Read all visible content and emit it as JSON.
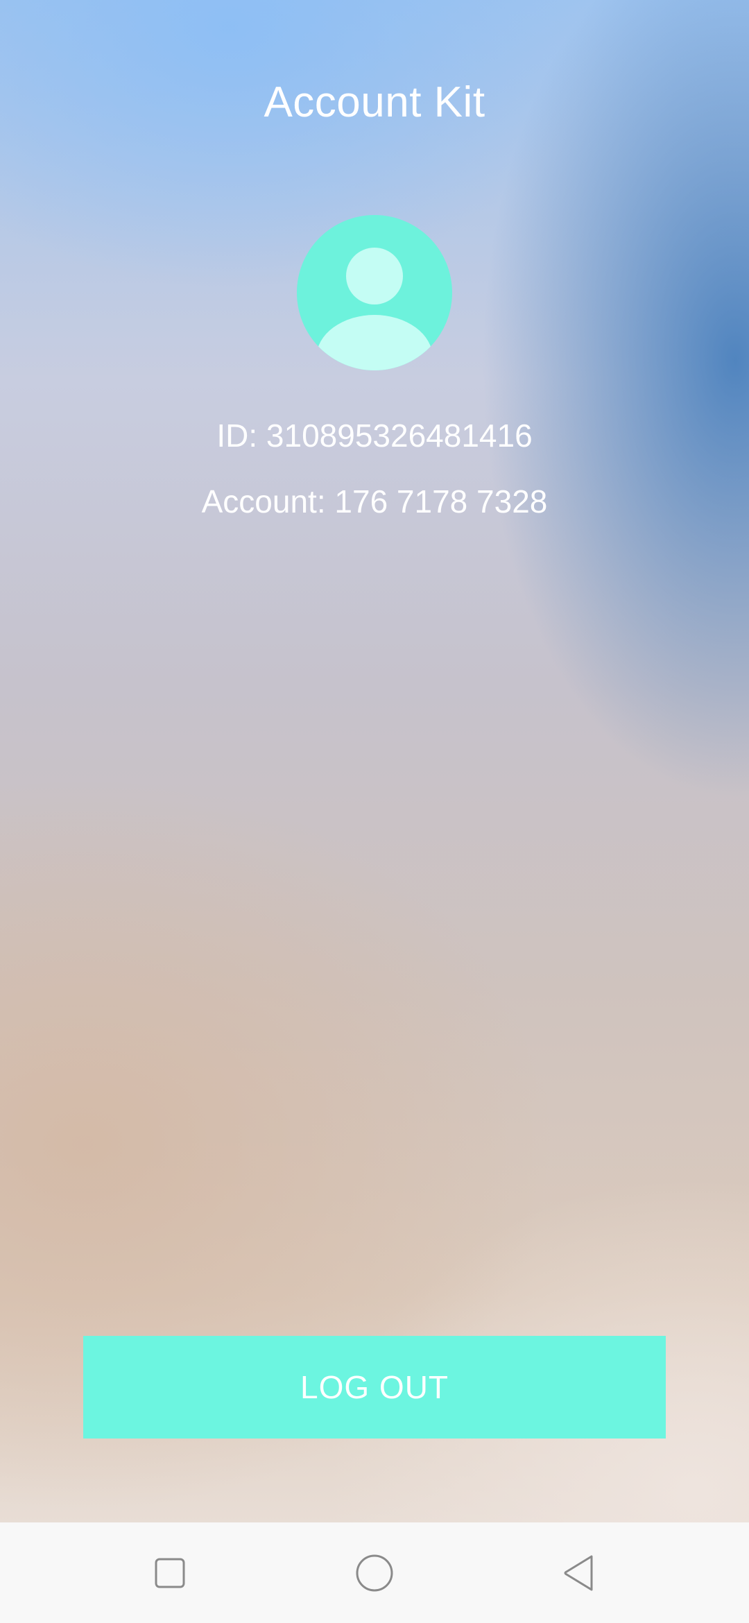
{
  "app": {
    "title": "Account Kit"
  },
  "profile": {
    "avatar_icon": "user-avatar-icon",
    "id_text": "ID: 310895326481416",
    "account_text": "Account: 176 7178 7328"
  },
  "actions": {
    "logout_label": "LOG OUT"
  },
  "navbar": {
    "recent_icon": "square-recent-apps-icon",
    "home_icon": "circle-home-icon",
    "back_icon": "triangle-back-icon"
  },
  "colors": {
    "accent": "#6CF5E0",
    "avatar_bg": "#6DF2DC",
    "avatar_figure": "#C4FDF4",
    "text": "#FFFFFF",
    "navbar_bg": "#F8F8F8",
    "nav_icon": "#8A8A8A"
  }
}
